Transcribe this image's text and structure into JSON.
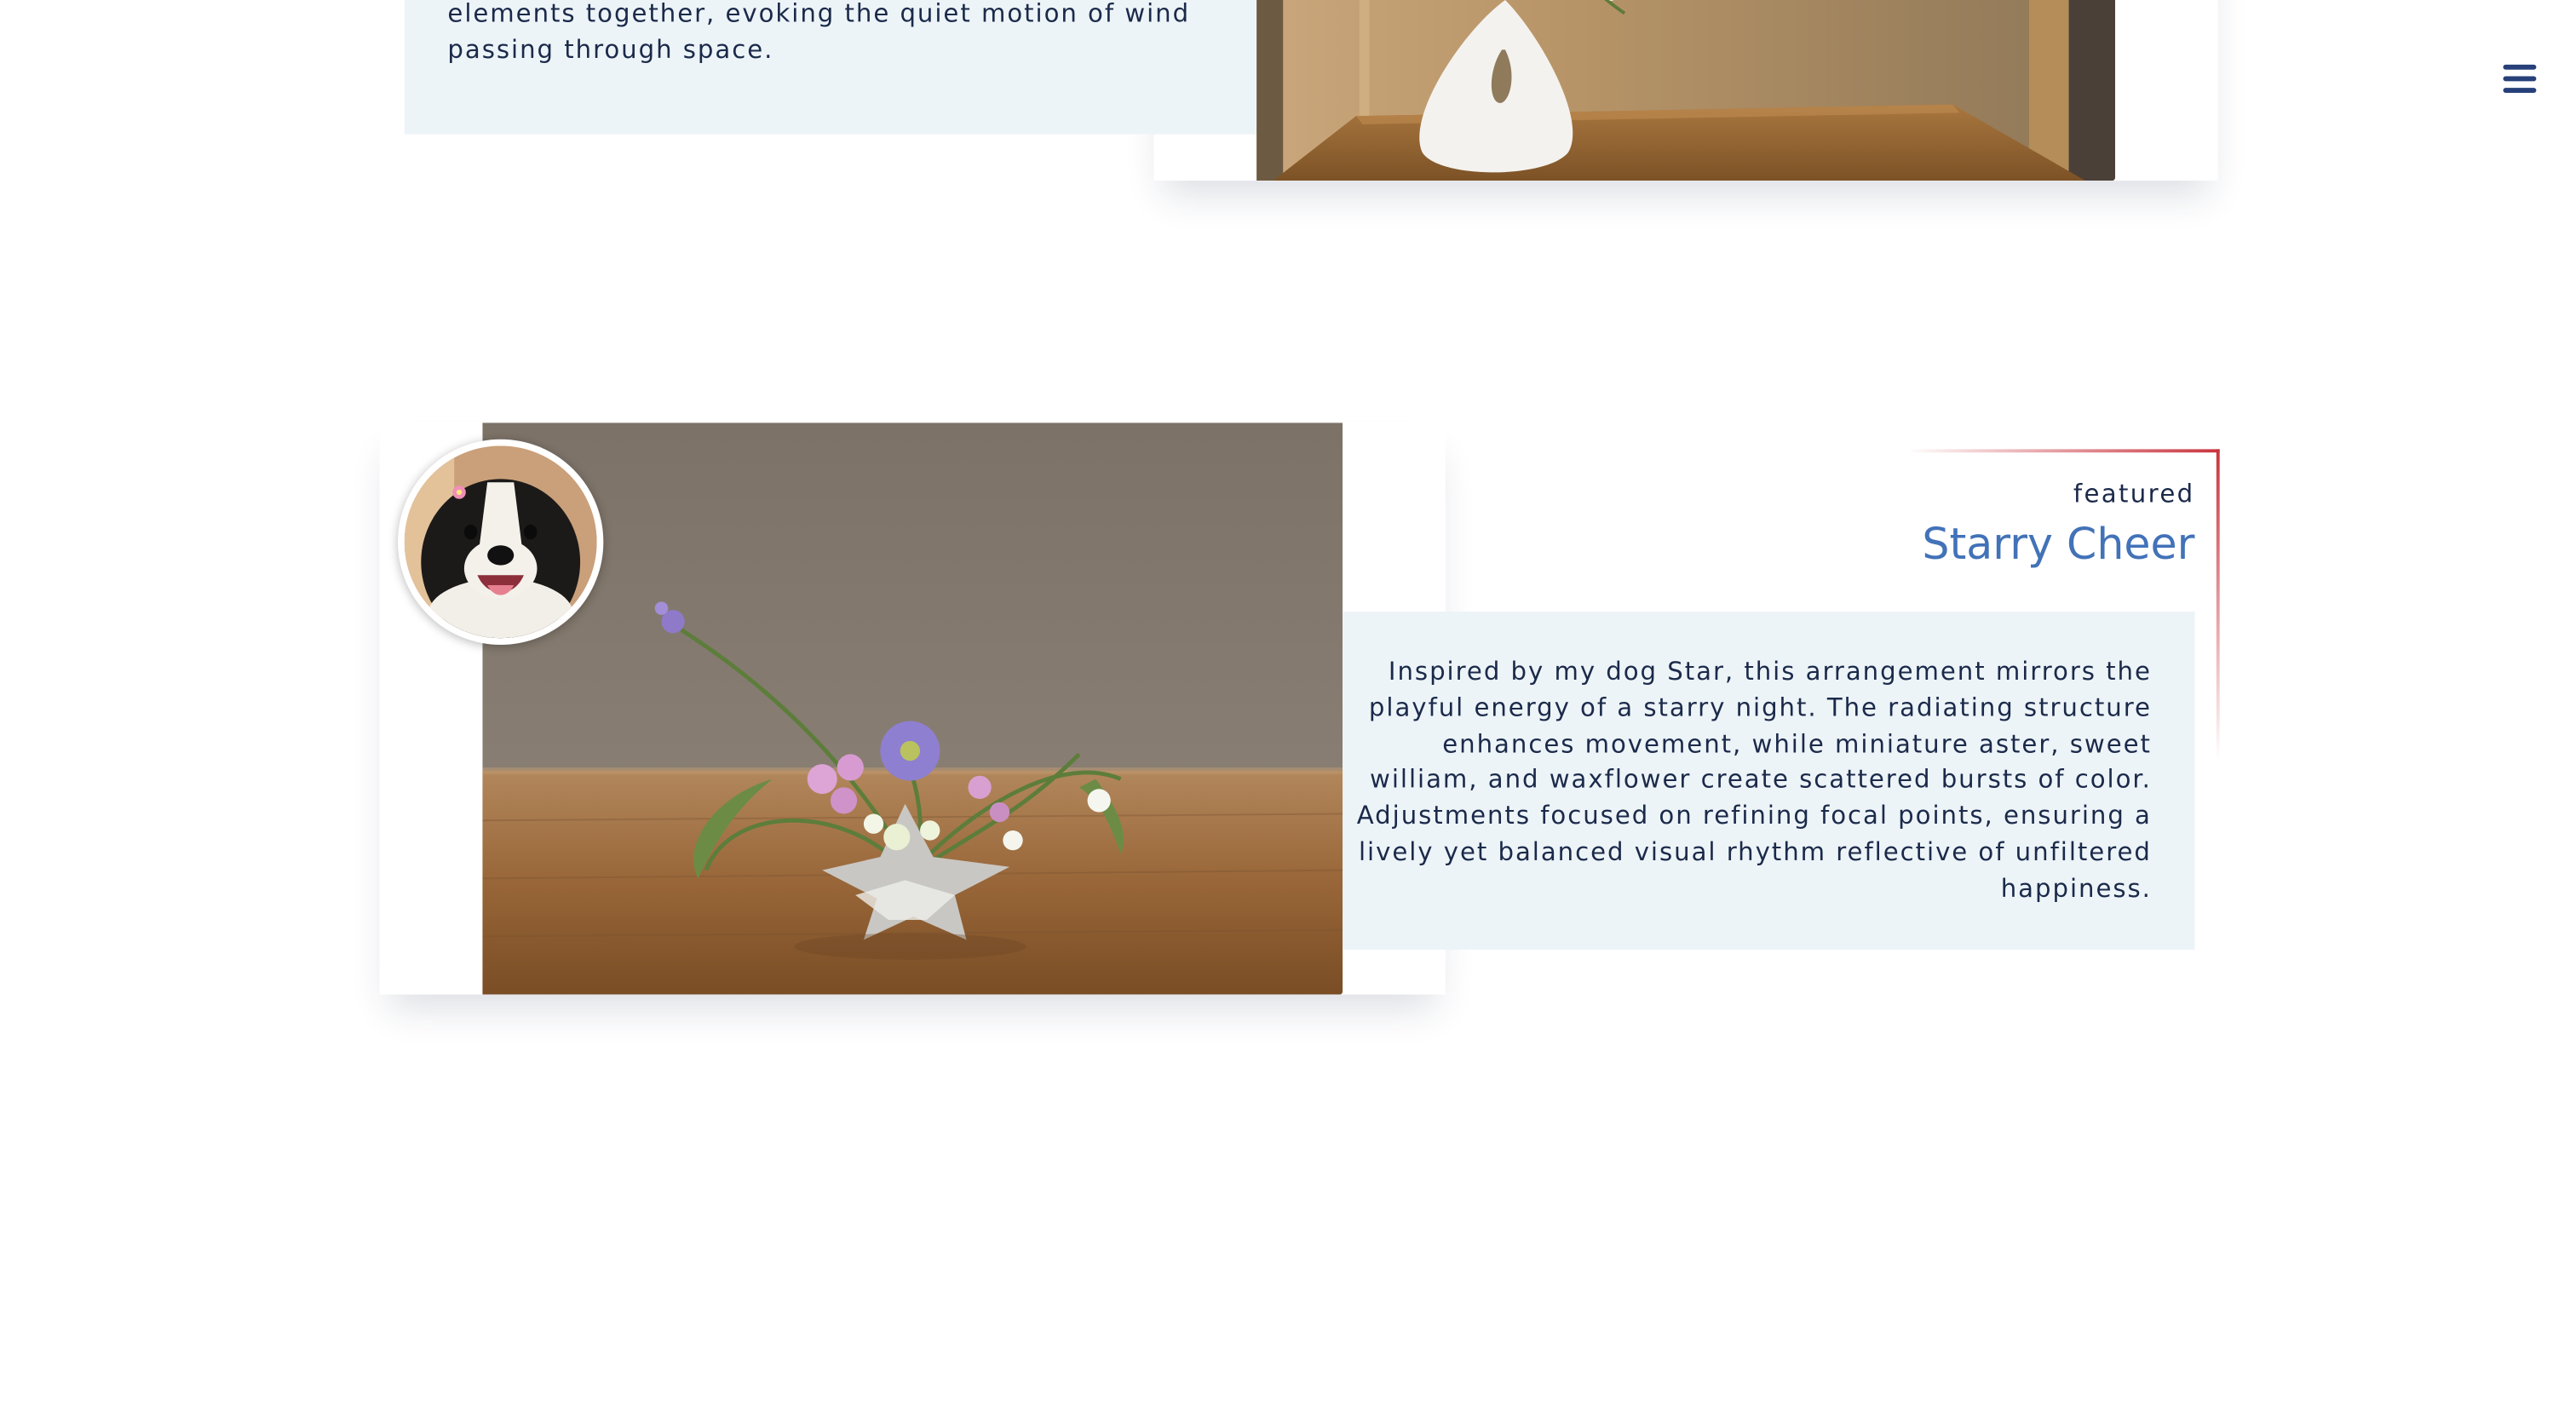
{
  "menu": {
    "icon": "hamburger-menu-icon"
  },
  "card1": {
    "description": "was added post-critique, introducing dots to tie the elements together, evoking the quiet motion of wind passing through space."
  },
  "card2": {
    "tag": "featured",
    "title": "Starry Cheer",
    "description": "Inspired by my dog Star, this arrangement mirrors the playful energy of a starry night. The radiating structure enhances movement, while miniature aster, sweet william, and waxflower create scattered bursts of color. Adjustments focused on refining focal points, ensuring a lively yet balanced visual rhythm reflective of unfiltered happiness."
  },
  "colors": {
    "title_blue": "#4272b8",
    "text_navy": "#1b2a4a",
    "accent_red": "#c9343e",
    "panel_bg": "#edf4f8"
  }
}
